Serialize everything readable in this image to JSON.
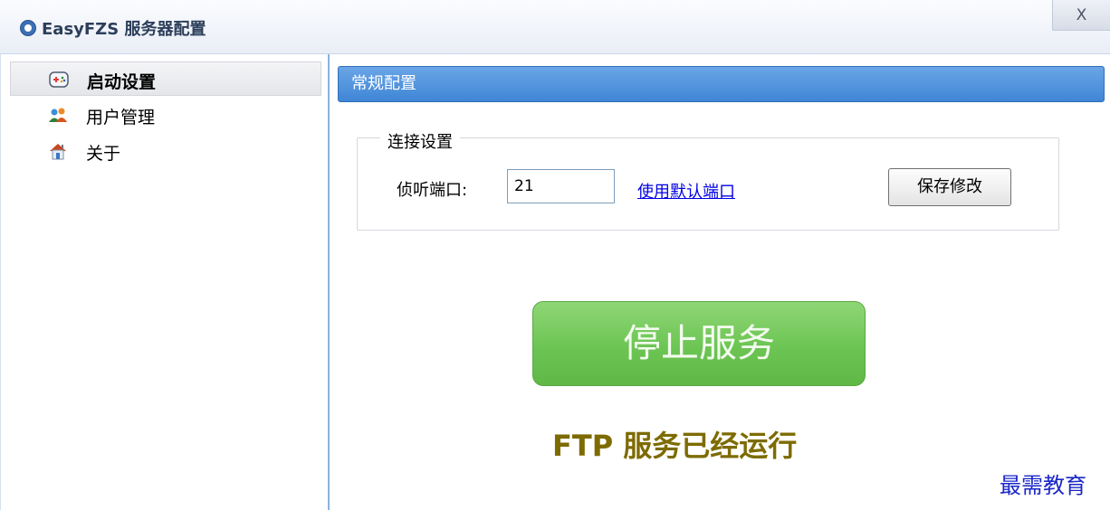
{
  "window": {
    "title": "EasyFZS 服务器配置",
    "close_label": "X",
    "app_icon": "app-logo-icon"
  },
  "sidebar": {
    "items": [
      {
        "label": "启动设置",
        "icon": "gamepad-icon",
        "active": true
      },
      {
        "label": "用户管理",
        "icon": "users-icon",
        "active": false
      },
      {
        "label": "关于",
        "icon": "home-icon",
        "active": false
      }
    ]
  },
  "main": {
    "section_title": "常规配置",
    "connection": {
      "group_title": "连接设置",
      "port_label": "侦听端口:",
      "port_value": "21",
      "default_port_link": "使用默认端口",
      "save_label": "保存修改"
    },
    "stop_button_label": "停止服务",
    "status_text": "FTP 服务已经运行"
  },
  "watermark": "最需教育",
  "colors": {
    "header_blue": "#3f86d6",
    "button_green": "#6cc553",
    "status_olive": "#7d6b00",
    "link_blue": "#0000e6"
  }
}
